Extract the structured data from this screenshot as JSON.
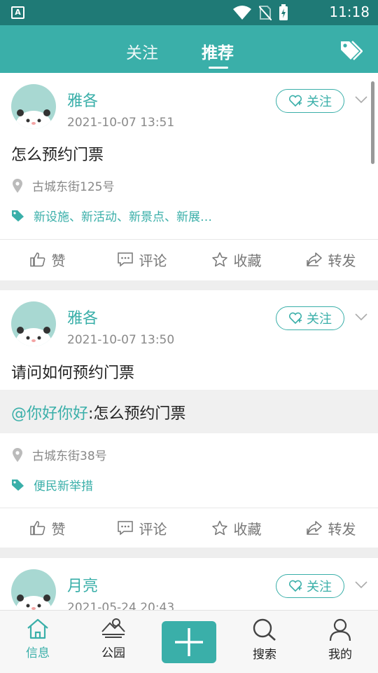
{
  "status_bar": {
    "time": "11:18",
    "app_icon_letter": "A"
  },
  "top_nav": {
    "tabs": [
      {
        "label": "关注"
      },
      {
        "label": "推荐"
      }
    ],
    "active_tab": "推荐"
  },
  "posts": [
    {
      "author": "雅各",
      "date": "2021-10-07 13:51",
      "follow_label": "关注",
      "content": "怎么预约门票",
      "location": "古城东街125号",
      "tags": "新设施、新活动、新景点、新展…",
      "actions": {
        "like": "赞",
        "comment": "评论",
        "collect": "收藏",
        "share": "转发"
      }
    },
    {
      "author": "雅各",
      "date": "2021-10-07 13:50",
      "follow_label": "关注",
      "content": "请问如何预约门票",
      "quote": {
        "mention": "@你好你好",
        "text": ":怎么预约门票"
      },
      "location": "古城东街38号",
      "tags": "便民新举措",
      "actions": {
        "like": "赞",
        "comment": "评论",
        "collect": "收藏",
        "share": "转发"
      }
    },
    {
      "author": "月亮",
      "date": "2021-05-24 20:43",
      "follow_label": "关注"
    }
  ],
  "bottom_nav": {
    "items": [
      {
        "label": "信息"
      },
      {
        "label": "公园"
      },
      {
        "label": "搜索"
      },
      {
        "label": "我的"
      }
    ],
    "active": "信息"
  },
  "colors": {
    "accent": "#3aafa9",
    "status_bar": "#1f7a76",
    "text": "#222222",
    "muted": "#8a8a8a"
  }
}
